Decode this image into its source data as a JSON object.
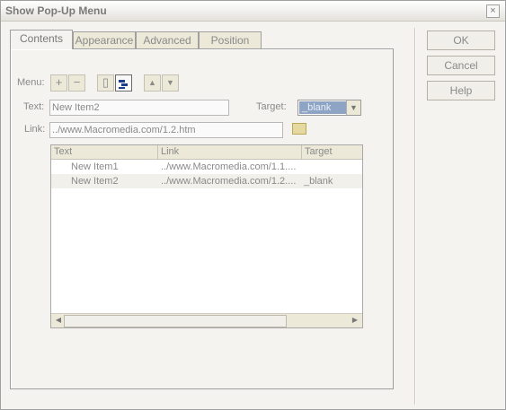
{
  "window": {
    "title": "Show Pop-Up Menu",
    "close_glyph": "×"
  },
  "tabs": [
    {
      "label": "Contents"
    },
    {
      "label": "Appearance"
    },
    {
      "label": "Advanced"
    },
    {
      "label": "Position"
    }
  ],
  "buttons": {
    "ok": "OK",
    "cancel": "Cancel",
    "help": "Help"
  },
  "menu": {
    "label": "Menu:",
    "add": "+",
    "remove": "−",
    "outdent": "▯",
    "indent": "▤",
    "move_up": "▲",
    "move_down": "▼"
  },
  "fields": {
    "text_label": "Text:",
    "text_value": "New Item2",
    "target_label": "Target:",
    "target_value": "_blank",
    "link_label": "Link:",
    "link_value": "../www.Macromedia.com/1.2.htm"
  },
  "table": {
    "headers": [
      "Text",
      "Link",
      "Target"
    ],
    "rows": [
      {
        "text": "New Item1",
        "link": "../www.Macromedia.com/1.1....",
        "target": ""
      },
      {
        "text": "New Item2",
        "link": "../www.Macromedia.com/1.2....",
        "target": "_blank"
      }
    ]
  }
}
